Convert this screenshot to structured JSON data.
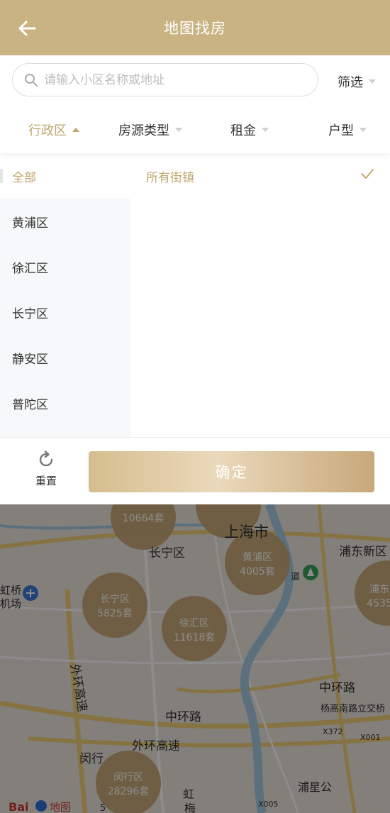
{
  "header": {
    "title": "地图找房"
  },
  "search": {
    "placeholder": "请输入小区名称或地址",
    "filter_label": "筛选"
  },
  "tabs": [
    {
      "label": "行政区",
      "active": true
    },
    {
      "label": "房源类型",
      "active": false
    },
    {
      "label": "租金",
      "active": false
    },
    {
      "label": "户型",
      "active": false
    }
  ],
  "districts": [
    "全部",
    "黄浦区",
    "徐汇区",
    "长宁区",
    "静安区",
    "普陀区"
  ],
  "streets": {
    "selected": "所有街镇"
  },
  "bottom": {
    "reset_label": "重置",
    "confirm_label": "确定"
  },
  "map": {
    "labels": {
      "shanghai": "上海市",
      "changning": "长宁区",
      "pudong": "浦东新区",
      "hongqiao": "虹桥",
      "airport": "机场",
      "ring_outer": "外环高速",
      "ring_outer_v": "外环高速",
      "ring_mid": "中环路",
      "ring_mid2": "中环路",
      "yanggao": "杨高南路立交桥",
      "minhang": "闵行",
      "hong": "虹",
      "mei": "梅",
      "pujiang": "浦星公",
      "dao": "道",
      "x372": "X372",
      "x001": "X001",
      "x005": "X005",
      "five": "5",
      "num_top": "10664套",
      "baidu": "Bai",
      "baidu_map": "地图"
    },
    "clusters": [
      {
        "name": "",
        "count": "10664套"
      },
      {
        "name": "黄浦区",
        "count": "4005套"
      },
      {
        "name": "浦东",
        "count": "4535"
      },
      {
        "name": "长宁区",
        "count": "5825套"
      },
      {
        "name": "徐汇区",
        "count": "11618套"
      },
      {
        "name": "闵行区",
        "count": "28296套"
      }
    ]
  },
  "colors": {
    "header": "#c9b382",
    "accent": "#c2a66e"
  }
}
